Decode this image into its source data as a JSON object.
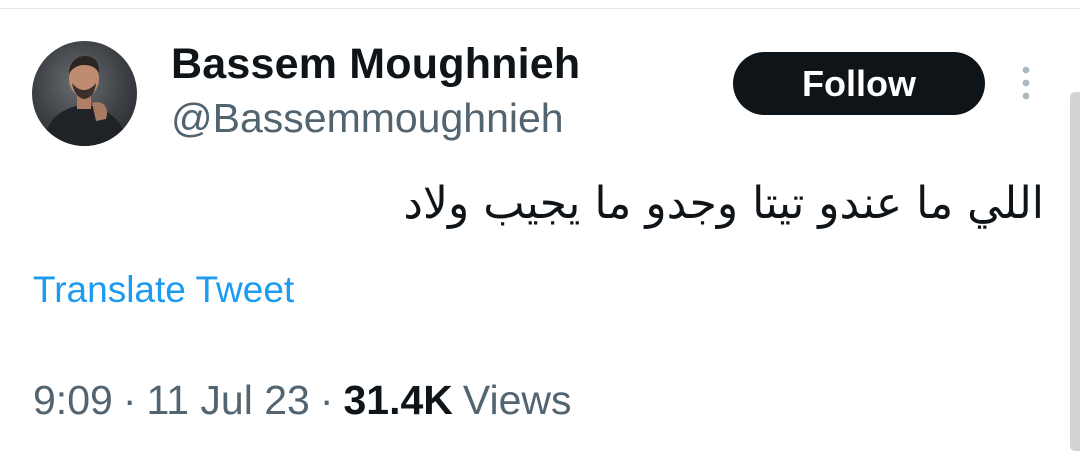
{
  "author": {
    "display_name": "Bassem Moughnieh",
    "handle": "@Bassemmoughnieh",
    "avatar_icon": "profile-photo"
  },
  "actions": {
    "follow_label": "Follow",
    "more_icon": "vertical-ellipsis-icon"
  },
  "tweet": {
    "text": "اللي ما عندو تيتا وجدو ما يجيب ولاد",
    "translate_label": "Translate Tweet"
  },
  "meta": {
    "time": "9:09",
    "separator": "·",
    "date": "11 Jul 23",
    "views_count": "31.4K",
    "views_label": "Views"
  },
  "colors": {
    "text_primary": "#0f1419",
    "text_secondary": "#536471",
    "link": "#1d9bf0",
    "follow_bg": "#0f1419"
  }
}
